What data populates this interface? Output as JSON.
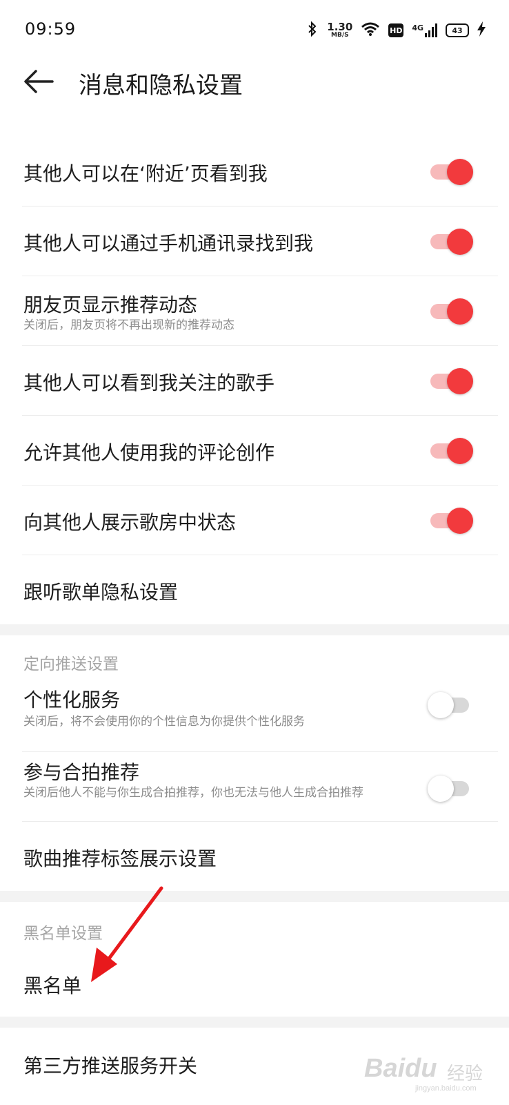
{
  "status_bar": {
    "time": "09:59",
    "speed_value": "1.30",
    "speed_unit": "MB/S",
    "hd": "HD",
    "network": "4G",
    "battery": "43"
  },
  "header": {
    "title": "消息和隐私设置",
    "back_icon": "back-arrow-icon"
  },
  "privacy_items": [
    {
      "label": "其他人可以在‘附近’页看到我",
      "enabled": true
    },
    {
      "label": "其他人可以通过手机通讯录找到我",
      "enabled": true
    },
    {
      "label": "朋友页显示推荐动态",
      "sub": "关闭后，朋友页将不再出现新的推荐动态",
      "enabled": true
    },
    {
      "label": "其他人可以看到我关注的歌手",
      "enabled": true
    },
    {
      "label": "允许其他人使用我的评论创作",
      "enabled": true
    },
    {
      "label": "向其他人展示歌房中状态",
      "enabled": true
    },
    {
      "label": "跟听歌单隐私设置"
    }
  ],
  "targeted_push": {
    "title": "定向推送设置",
    "items": [
      {
        "label": "个性化服务",
        "sub": "关闭后，将不会使用你的个性信息为你提供个性化服务",
        "enabled": false
      },
      {
        "label": "参与合拍推荐",
        "sub": "关闭后他人不能与你生成合拍推荐，你也无法与他人生成合拍推荐",
        "enabled": false
      },
      {
        "label": "歌曲推荐标签展示设置"
      }
    ]
  },
  "blacklist": {
    "title": "黑名单设置",
    "item": "黑名单"
  },
  "third_party": {
    "item": "第三方推送服务开关"
  },
  "watermark": {
    "logo": "Baidu",
    "cn": "经验",
    "url": "jingyan.baidu.com"
  },
  "colors": {
    "accent": "#f23a3d",
    "accent_track": "#f7b9ba",
    "section_gap": "#f3f3f3",
    "annotation_arrow": "#e8191c"
  }
}
